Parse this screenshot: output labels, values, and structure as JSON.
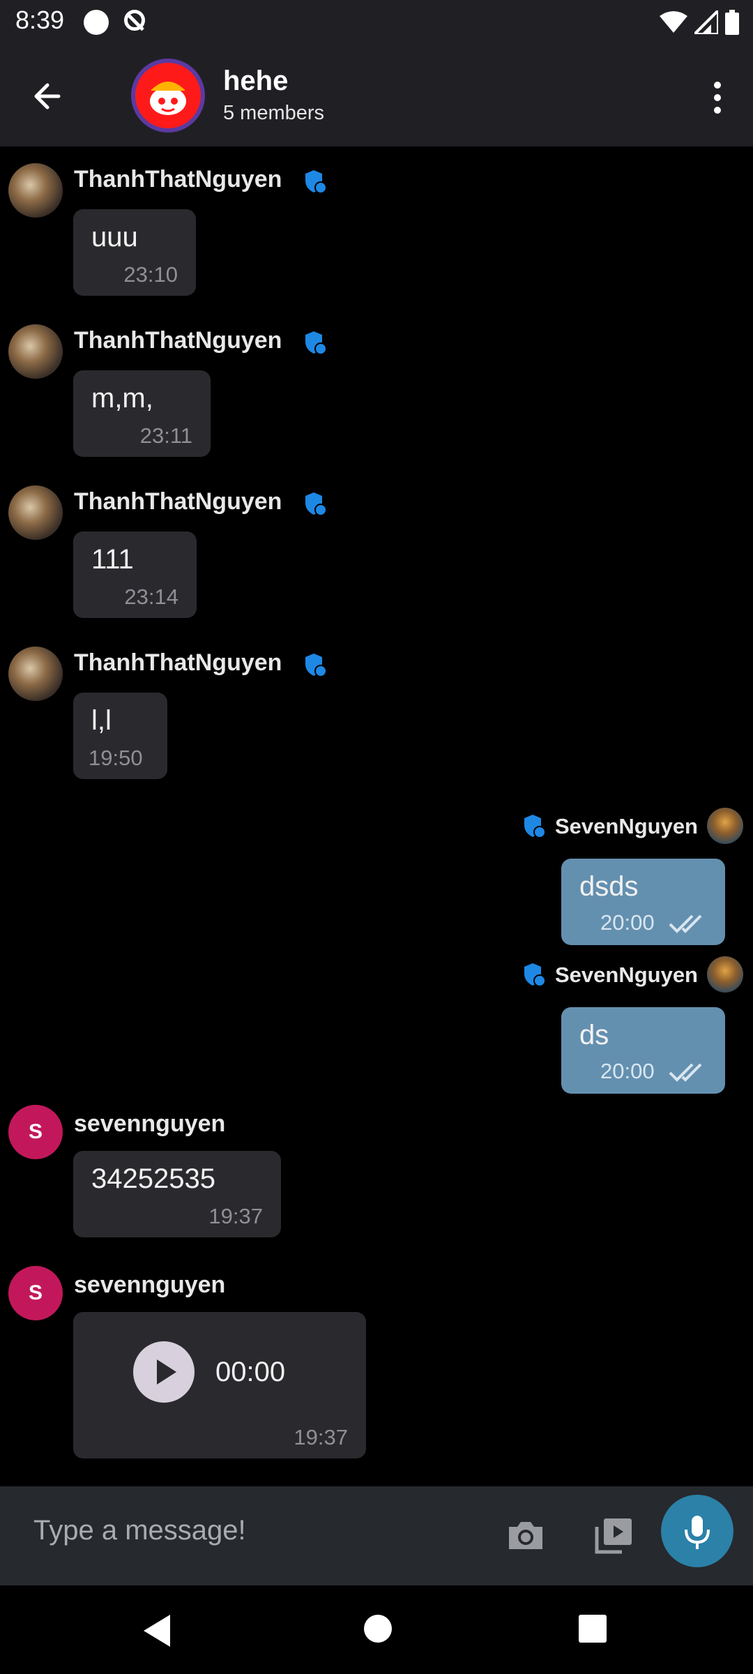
{
  "status_bar": {
    "time": "8:39"
  },
  "header": {
    "title": "hehe",
    "subtitle": "5 members"
  },
  "messages": [
    {
      "sender": "ThanhThatNguyen",
      "text": "uuu",
      "time": "23:10"
    },
    {
      "sender": "ThanhThatNguyen",
      "text": "m,m,",
      "time": "23:11"
    },
    {
      "sender": "ThanhThatNguyen",
      "text": "111",
      "time": "23:14"
    },
    {
      "sender": "ThanhThatNguyen",
      "text": "l,l",
      "time": "19:50"
    },
    {
      "sender": "SevenNguyen",
      "text": "dsds",
      "time": "20:00"
    },
    {
      "sender": "SevenNguyen",
      "text": "ds",
      "time": "20:00"
    },
    {
      "sender": "sevennguyen",
      "avatar_letter": "S",
      "text": "34252535",
      "time": "19:37"
    },
    {
      "sender": "sevennguyen",
      "avatar_letter": "S",
      "voice_duration": "00:00",
      "time": "19:37"
    }
  ],
  "composer": {
    "placeholder": "Type a message!"
  },
  "colors": {
    "accent": "#2b81a8",
    "incoming_bubble": "#2a2a2e",
    "outgoing_bubble": "#6490b0",
    "letter_avatar": "#c2185b",
    "verified_badge": "#1e88e5"
  },
  "icons": {
    "back": "arrow-left-icon",
    "menu": "more-vert-icon",
    "verified": "verified-shield-icon",
    "read": "double-check-icon",
    "play": "play-icon",
    "camera": "camera-icon",
    "media": "video-library-icon",
    "mic": "mic-icon"
  }
}
